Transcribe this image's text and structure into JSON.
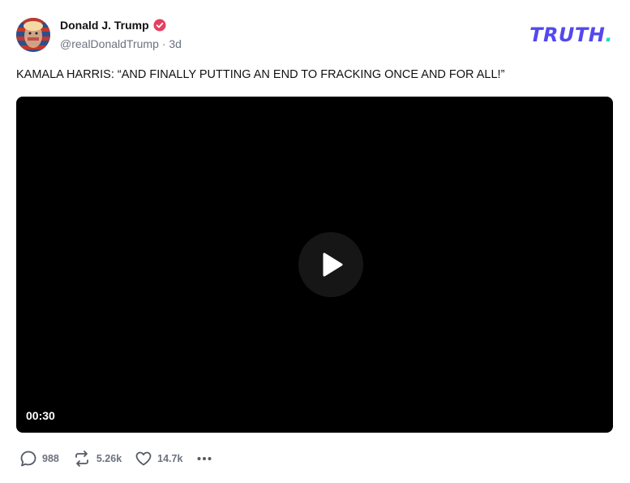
{
  "author": {
    "name": "Donald J. Trump",
    "handle": "@realDonaldTrump",
    "separator": "·",
    "time": "3d",
    "verified_color": "#e4405f"
  },
  "brand": {
    "logo_text": "TRUTH",
    "logo_dot": ".",
    "color": "#5448ee",
    "dot_color": "#17e0b5"
  },
  "post": {
    "text": "KAMALA HARRIS: “AND FINALLY PUTTING AN END TO FRACKING ONCE AND FOR ALL!”"
  },
  "video": {
    "duration": "00:30",
    "play_icon": "play-icon"
  },
  "actions": {
    "replies": "988",
    "retruths": "5.26k",
    "likes": "14.7k",
    "reply_icon": "comment-icon",
    "retruth_icon": "retruth-icon",
    "like_icon": "heart-icon",
    "more_icon": "more-icon"
  }
}
